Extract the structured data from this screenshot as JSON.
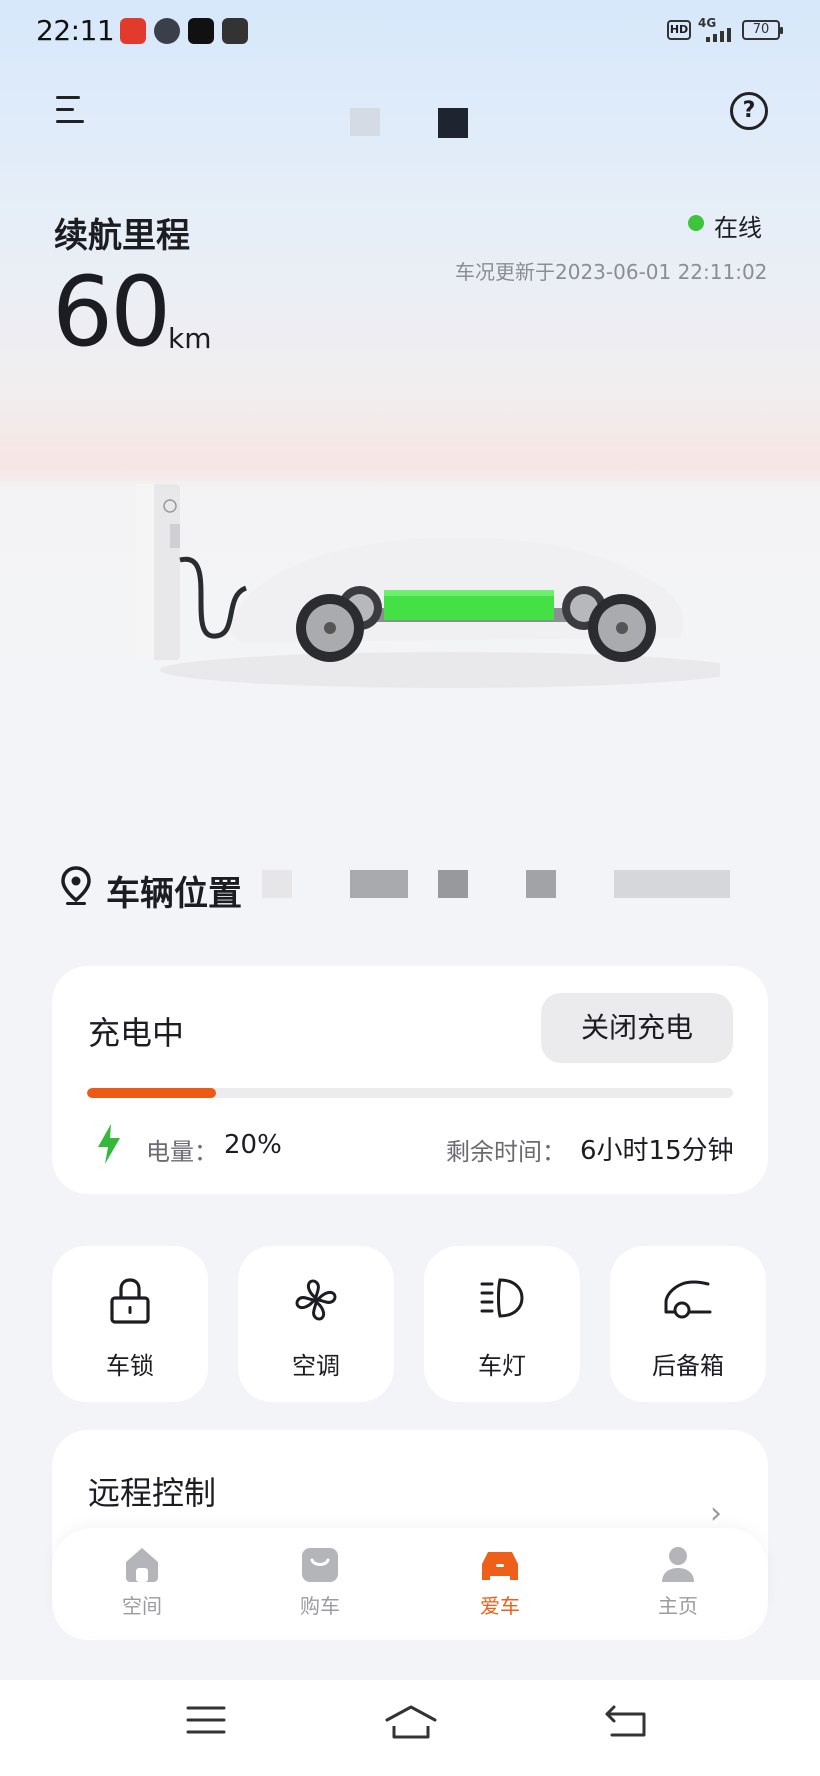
{
  "status_bar": {
    "time": "22:11",
    "network_hd": "HD",
    "network_type": "4G",
    "battery": "70"
  },
  "header": {
    "menu_icon": "menu-icon",
    "help_icon": "help-icon",
    "help_glyph": "?"
  },
  "range": {
    "label": "续航里程",
    "value": "60",
    "unit": "km",
    "status": "在线",
    "status_color": "#3cc43a",
    "updated": "车况更新于2023-06-01 22:11:02"
  },
  "location": {
    "label": "车辆位置"
  },
  "charging": {
    "title": "充电中",
    "stop_label": "关闭充电",
    "progress": 0.2,
    "accent": "#ec5a13",
    "level_label": "电量：",
    "level_value": "20%",
    "remaining_label": "剩余时间：",
    "remaining_value": "6小时15分钟"
  },
  "quick_controls": [
    {
      "label": "车锁",
      "icon": "lock-icon"
    },
    {
      "label": "空调",
      "icon": "fan-icon"
    },
    {
      "label": "车灯",
      "icon": "headlight-icon"
    },
    {
      "label": "后备箱",
      "icon": "trunk-icon"
    }
  ],
  "remote": {
    "title": "远程控制",
    "chevron": "›"
  },
  "bottom_nav": {
    "items": [
      {
        "label": "空间",
        "icon": "home-icon",
        "active": false
      },
      {
        "label": "购车",
        "icon": "bag-icon",
        "active": false
      },
      {
        "label": "爱车",
        "icon": "car-icon",
        "active": true
      },
      {
        "label": "主页",
        "icon": "person-icon",
        "active": false
      }
    ],
    "active_color": "#e6621c"
  }
}
